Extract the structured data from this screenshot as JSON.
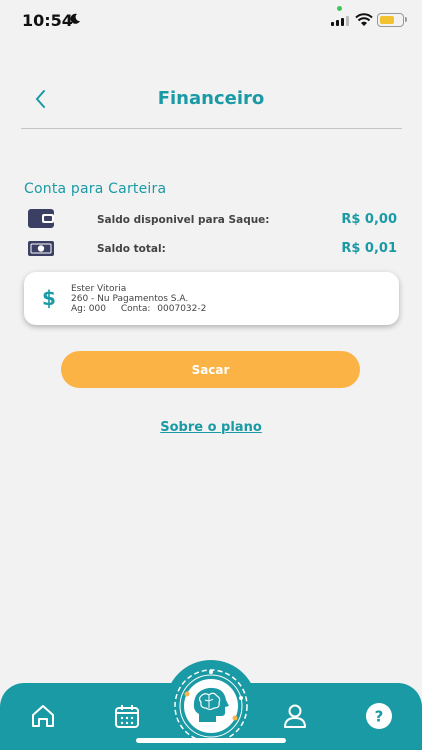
{
  "status_bar": {
    "time": "10:54"
  },
  "header": {
    "title": "Financeiro"
  },
  "wallet": {
    "section_title": "Conta para Carteira",
    "rows": [
      {
        "label": "Saldo disponivel para Saque:",
        "value": "R$ 0,00",
        "icon": "wallet-icon"
      },
      {
        "label": "Saldo total:",
        "value": "R$ 0,01",
        "icon": "cash-icon"
      }
    ]
  },
  "bank_account": {
    "icon": "dollar-icon",
    "dollar_symbol": "$",
    "holder": "Ester Vitoria",
    "bank": "260 - Nu Pagamentos S.A.",
    "agency_label": "Ag:",
    "agency": "000",
    "account_label": "Conta:",
    "account": "0007032-2"
  },
  "actions": {
    "withdraw_label": "Sacar",
    "plan_link": "Sobre o plano"
  },
  "bottom_nav": {
    "items": [
      "home-icon",
      "calendar-icon",
      "brain-logo-icon",
      "profile-icon",
      "help-icon"
    ],
    "help_symbol": "?"
  },
  "colors": {
    "primary": "#1a9aa4",
    "accent": "#fbb345",
    "background": "#f2f2f3"
  }
}
